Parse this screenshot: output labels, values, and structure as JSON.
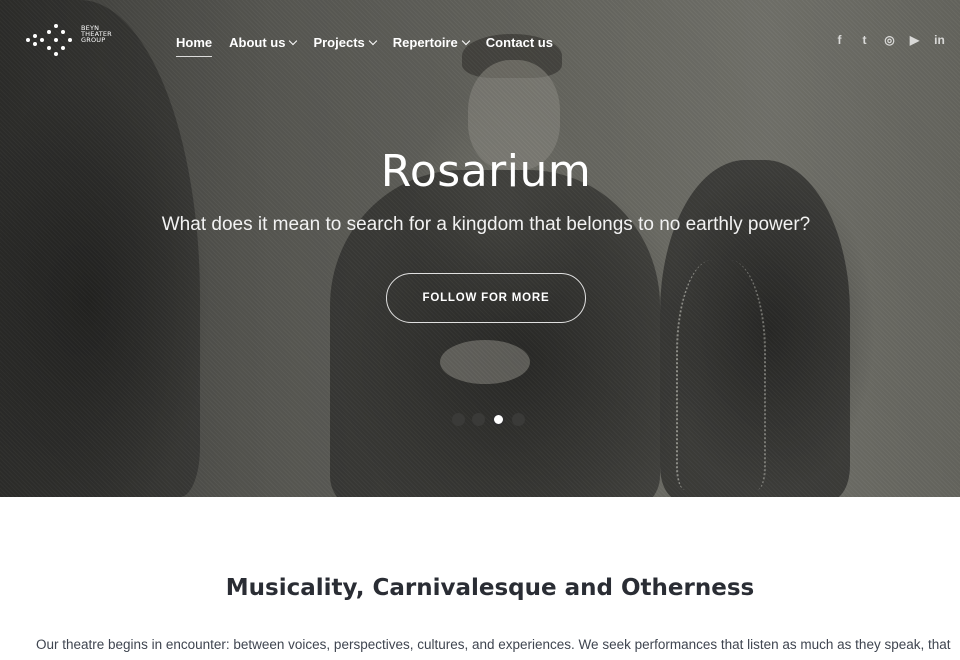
{
  "brand": {
    "logo_text_lines": [
      "BEYN",
      "THEATER",
      "GROUP"
    ]
  },
  "nav": {
    "items": [
      {
        "label": "Home",
        "active": true,
        "has_dropdown": false
      },
      {
        "label": "About us",
        "active": false,
        "has_dropdown": true
      },
      {
        "label": "Projects",
        "active": false,
        "has_dropdown": true
      },
      {
        "label": "Repertoire",
        "active": false,
        "has_dropdown": true
      },
      {
        "label": "Contact us",
        "active": false,
        "has_dropdown": false
      }
    ]
  },
  "social": {
    "icons": [
      "facebook-icon",
      "twitter-icon",
      "instagram-icon",
      "youtube-icon",
      "linkedin-icon"
    ],
    "glyphs": [
      "f",
      "t",
      "◎",
      "▶",
      "in"
    ]
  },
  "hero": {
    "title": "Rosarium",
    "subtitle": "What does it mean to search for a kingdom that belongs to no earthly power?",
    "button_label": "FOLLOW FOR MORE",
    "slides_total": 4,
    "active_slide": 3
  },
  "section": {
    "title": "Musicality, Carnivalesque and Otherness",
    "body": "Our theatre begins in encounter: between voices, perspectives, cultures, and experiences. We seek performances that listen as much as they speak, that"
  },
  "colors": {
    "hero_base": "#6a6a64",
    "text_dark": "#2a2d34",
    "body_text": "#3f4550",
    "white": "#ffffff"
  }
}
